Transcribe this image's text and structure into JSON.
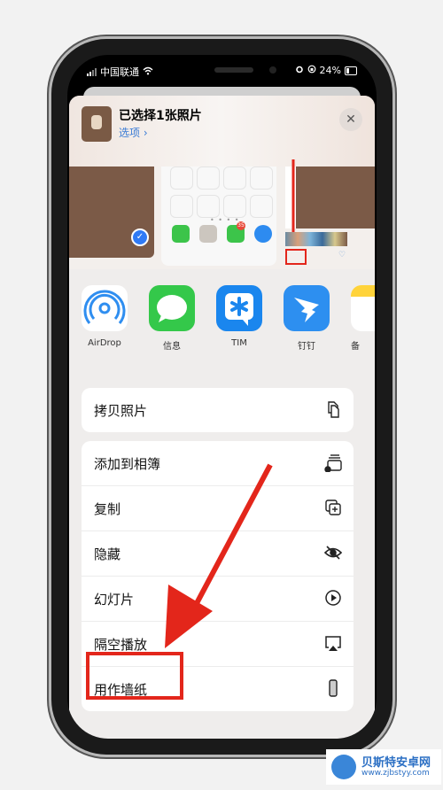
{
  "status_bar": {
    "carrier": "中国联通",
    "battery_percent": "24%",
    "icons": [
      "signal-icon",
      "wifi-icon",
      "alarm-icon",
      "orientation-lock-icon",
      "battery-icon"
    ]
  },
  "share_sheet": {
    "title": "已选择1张照片",
    "options_link": "选项 ›",
    "close_label": "✕",
    "preview": {
      "badge_count": "35",
      "selected_check": "✓"
    },
    "apps": [
      {
        "label": "AirDrop",
        "icon": "airdrop-icon"
      },
      {
        "label": "信息",
        "icon": "messages-icon"
      },
      {
        "label": "TIM",
        "icon": "tim-icon"
      },
      {
        "label": "钉钉",
        "icon": "dingtalk-icon"
      },
      {
        "label": "备",
        "icon": "notes-icon"
      }
    ],
    "action_groups": [
      {
        "items": [
          {
            "label": "拷贝照片",
            "icon": "copy-photo-icon"
          }
        ]
      },
      {
        "items": [
          {
            "label": "添加到相簿",
            "icon": "add-to-album-icon"
          },
          {
            "label": "复制",
            "icon": "duplicate-icon"
          },
          {
            "label": "隐藏",
            "icon": "hide-eye-icon"
          },
          {
            "label": "幻灯片",
            "icon": "play-circle-icon"
          },
          {
            "label": "隔空播放",
            "icon": "airplay-icon"
          },
          {
            "label": "用作墙纸",
            "icon": "iphone-icon"
          }
        ]
      }
    ]
  },
  "annotation": {
    "color": "#e3261b",
    "highlighted_item": "用作墙纸"
  },
  "watermark": {
    "name": "贝斯特安卓网",
    "url": "www.zjbstyy.com"
  }
}
